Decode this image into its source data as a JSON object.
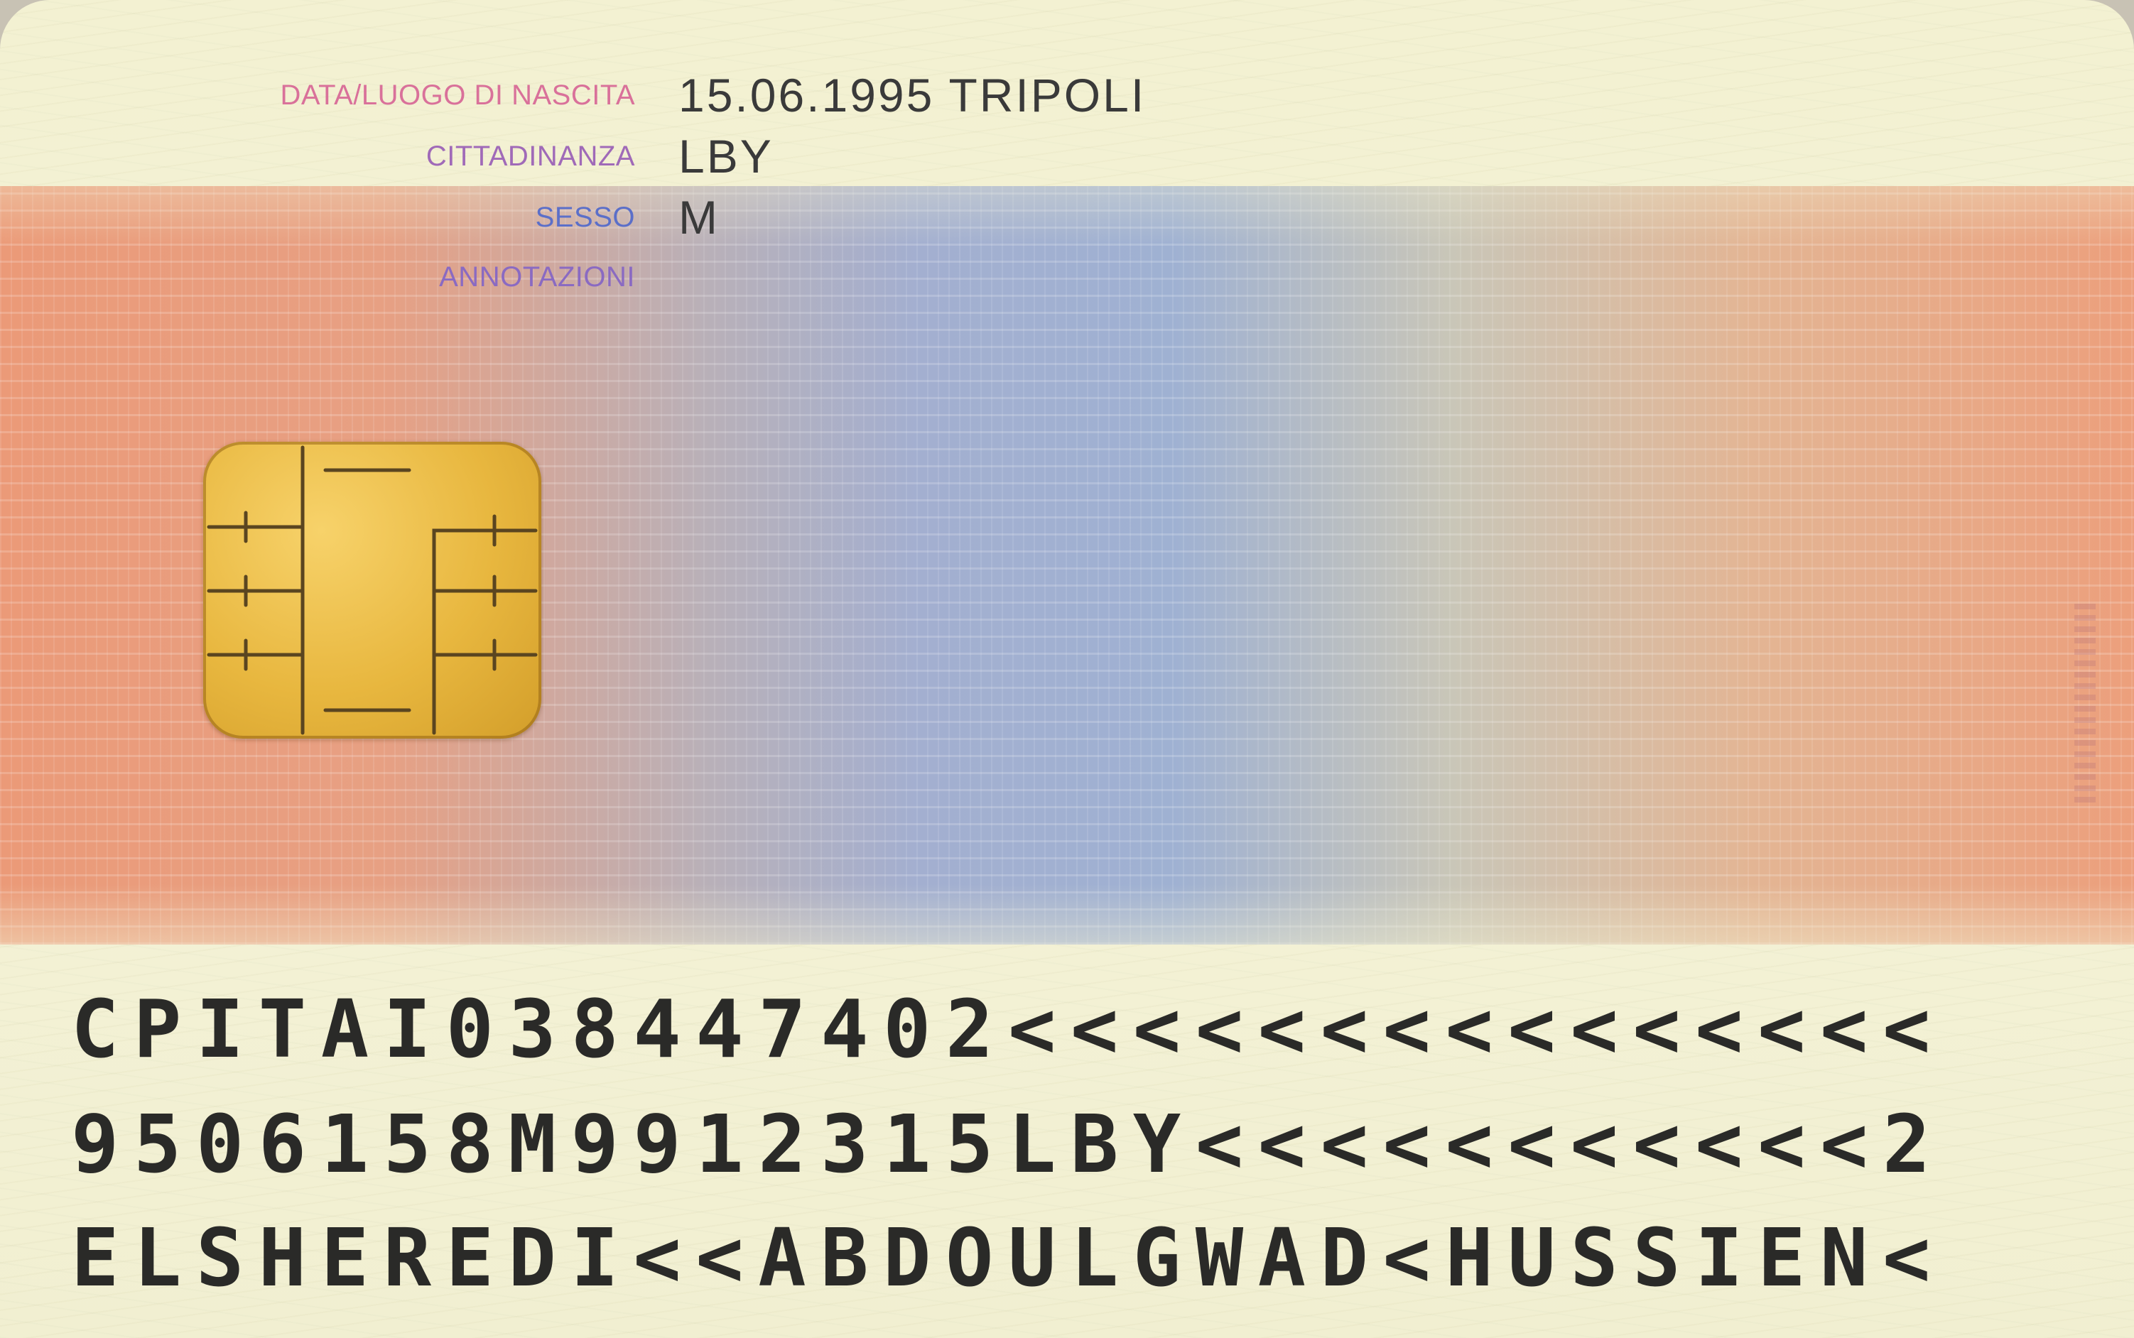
{
  "card": {
    "fields": [
      {
        "label": "DATA/LUOGO DI NASCITA",
        "value": "15.06.1995 TRIPOLI",
        "label_color": "#d9719a"
      },
      {
        "label": "CITTADINANZA",
        "value": "LBY",
        "label_color": "#a06ab8"
      },
      {
        "label": "SESSO",
        "value": "M",
        "label_color": "#5b6fc9"
      },
      {
        "label": "ANNOTAZIONI",
        "value": "",
        "label_color": "#8a6ac2"
      }
    ],
    "mrz": [
      "CPITAI038447402<<<<<<<<<<<<<<<",
      "9506158M9912315LBY<<<<<<<<<<<2",
      "ELSHEREDI<<ABDOULGWAD<HUSSIEN<"
    ],
    "chip_icon": "smartcard-chip-icon",
    "background_colors": {
      "card": "#f3f1d2",
      "band_orange": "#eb9a78",
      "band_blue": "#a3afd0"
    }
  }
}
